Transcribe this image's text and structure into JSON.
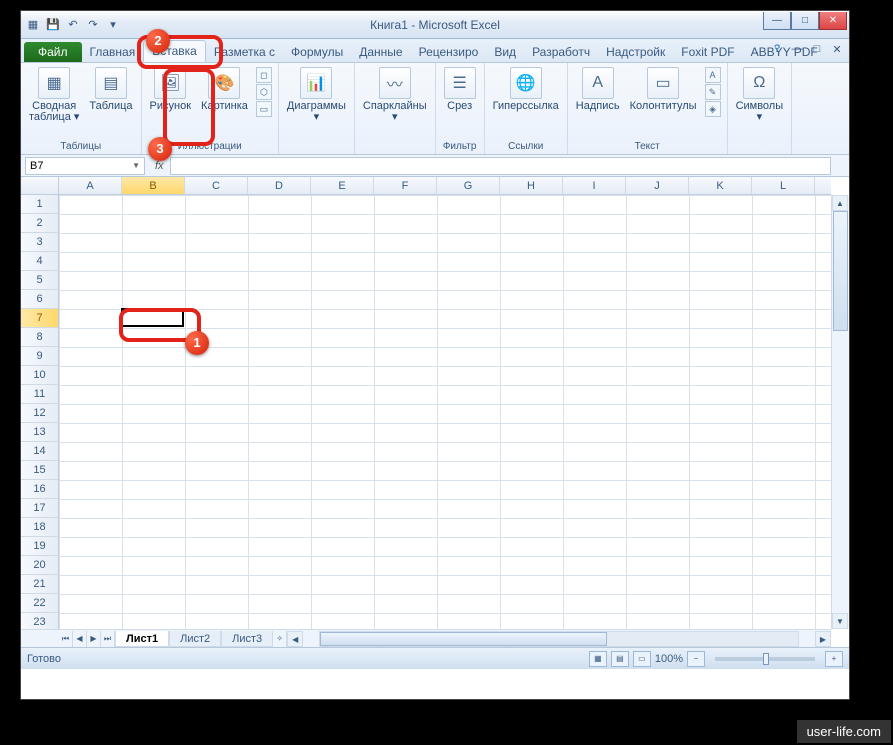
{
  "title": "Книга1 - Microsoft Excel",
  "tabs": {
    "file": "Файл",
    "items": [
      "Главная",
      "Вставка",
      "Разметка с",
      "Формулы",
      "Данные",
      "Рецензиро",
      "Вид",
      "Разработч",
      "Надстройк",
      "Foxit PDF",
      "ABBYY PDF"
    ],
    "active": 1
  },
  "ribbon": {
    "groups": [
      {
        "label": "Таблицы",
        "items": [
          {
            "label": "Сводная\nтаблица",
            "dd": true
          },
          {
            "label": "Таблица"
          }
        ]
      },
      {
        "label": "Иллюстрации",
        "items": [
          {
            "label": "Рисунок"
          },
          {
            "label": "Картинка"
          }
        ],
        "sm": [
          "shapes",
          "smartart",
          "screenshot"
        ]
      },
      {
        "label": "",
        "items": [
          {
            "label": "Диаграммы",
            "dd": true
          }
        ]
      },
      {
        "label": "",
        "items": [
          {
            "label": "Спарклайны",
            "dd": true
          }
        ]
      },
      {
        "label": "Фильтр",
        "items": [
          {
            "label": "Срез"
          }
        ]
      },
      {
        "label": "Ссылки",
        "items": [
          {
            "label": "Гиперссылка"
          }
        ]
      },
      {
        "label": "Текст",
        "items": [
          {
            "label": "Надпись"
          },
          {
            "label": "Колонтитулы"
          }
        ],
        "sm": [
          "wordart",
          "sigline",
          "object"
        ]
      },
      {
        "label": "",
        "items": [
          {
            "label": "Символы",
            "dd": true
          }
        ]
      }
    ]
  },
  "namebox": "B7",
  "cols": [
    "A",
    "B",
    "C",
    "D",
    "E",
    "F",
    "G",
    "H",
    "I",
    "J",
    "K",
    "L"
  ],
  "rows": [
    "1",
    "2",
    "3",
    "4",
    "5",
    "6",
    "7",
    "8",
    "9",
    "10",
    "11",
    "12",
    "13",
    "14",
    "15",
    "16",
    "17",
    "18",
    "19",
    "20",
    "21",
    "22",
    "23"
  ],
  "selected": {
    "col": 1,
    "row": 6
  },
  "sheets": [
    "Лист1",
    "Лист2",
    "Лист3"
  ],
  "status": "Готово",
  "zoom": "100%",
  "badges": {
    "b1": "1",
    "b2": "2",
    "b3": "3"
  },
  "watermark": "user-life.com"
}
